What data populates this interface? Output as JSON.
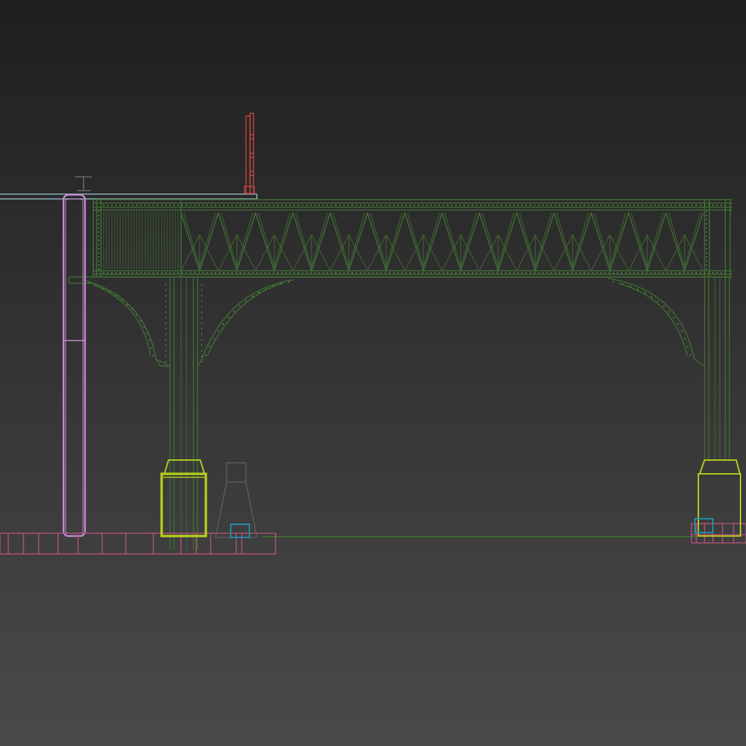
{
  "viewport": {
    "background_top": "#1f1f1f",
    "background_bottom": "#4a4a4a"
  },
  "wire_colors": {
    "truss": "#3f6b33",
    "truss_light": "#4e8040",
    "post_pink": "#c98ad6",
    "footing": "#b8cc1c",
    "base_block": "#b0507a",
    "roof_line": "#8fb4c0",
    "mast_red": "#c0433f",
    "small_cyan": "#1f8fa8",
    "hydrant_gray": "#5c5c5c",
    "cap_gray": "#6a6a6a"
  }
}
